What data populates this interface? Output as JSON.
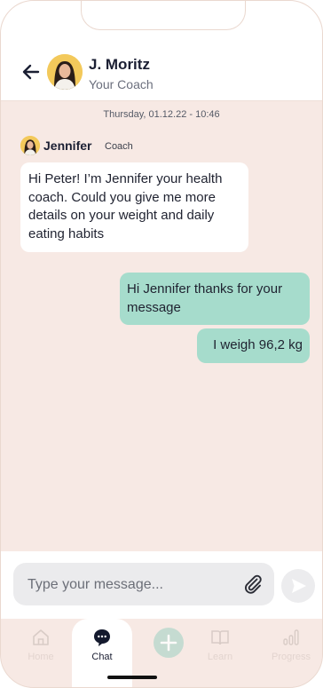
{
  "header": {
    "coach_name": "J. Moritz",
    "coach_role": "Your Coach"
  },
  "chat": {
    "date_stamp": "Thursday, 01.12.22 - 10:46",
    "messages": [
      {
        "direction": "incoming",
        "sender_name": "Jennifer",
        "sender_role": "Coach",
        "text": "Hi Peter! I’m Jennifer your health coach. Could you give me more details on your weight and daily eating habits"
      },
      {
        "direction": "outgoing",
        "text": "Hi Jennifer thanks for your message"
      },
      {
        "direction": "outgoing",
        "text": "I weigh 96,2 kg"
      }
    ]
  },
  "composer": {
    "placeholder": "Type your message...",
    "value": ""
  },
  "tabbar": {
    "items": [
      {
        "label": "Home",
        "icon": "home-icon",
        "active": false
      },
      {
        "label": "Chat",
        "icon": "chat-icon",
        "active": true
      },
      {
        "label": "",
        "icon": "plus-icon",
        "active": false
      },
      {
        "label": "Learn",
        "icon": "book-icon",
        "active": false
      },
      {
        "label": "Progress",
        "icon": "bar-chart-icon",
        "active": false
      }
    ]
  },
  "colors": {
    "background": "#f7e9e4",
    "outgoing_bubble": "#a6dccc",
    "incoming_bubble": "#ffffff",
    "plus_button": "#b9d8cd"
  }
}
